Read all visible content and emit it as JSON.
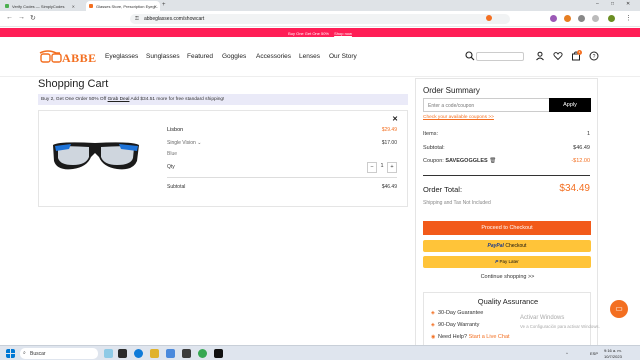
{
  "browser": {
    "tabs": [
      {
        "label": "Verify Codes — SimplyCodes"
      },
      {
        "label": "Glasses Store, Prescription Eyeg..."
      }
    ],
    "url": "abbeglasses.com/showcart"
  },
  "promo_bar": {
    "text": "Buy One Get One 50%",
    "link": "Shop now"
  },
  "header": {
    "logo_text": "ABBE",
    "nav": [
      "Eyeglasses",
      "Sunglasses",
      "Featured",
      "Goggles",
      "Accessories",
      "Lenses",
      "Our Story"
    ],
    "cart_count": "1"
  },
  "page": {
    "title": "Shopping Cart",
    "promo_strip": {
      "before": "Buy 2, Get One Order 50% Off ",
      "link": "Grab Deal",
      "after": "  Add $34.51 more for free standard shipping!"
    }
  },
  "cart_item": {
    "name": "Lisbon",
    "price": "$29.49",
    "lens": "Single Vision",
    "lens_price": "$17.00",
    "color": "Blue",
    "qty_label": "Qty",
    "qty": "1",
    "subtotal_label": "Subtotal",
    "subtotal": "$46.49"
  },
  "summary": {
    "title": "Order Summary",
    "coupon_placeholder": "Enter a code/coupon",
    "apply_label": "Apply",
    "coupon_link": "Check your available coupons >>",
    "items_label": "Items:",
    "items_value": "1",
    "subtotal_label": "Subtotal:",
    "subtotal_value": "$46.49",
    "coupon_label": "Coupon:",
    "coupon_code": "SAVEGOGGLES",
    "coupon_value": "-$12.00",
    "total_label": "Order Total:",
    "total_value": "$34.49",
    "shipping_note": "Shipping and Tax Not Included",
    "checkout_label": "Proceed to Checkout",
    "paypal_brand": "PayPal",
    "paypal_label": "Checkout",
    "paylater_label": "Pay Later",
    "continue_label": "Continue shopping >>",
    "qa_title": "Quality Assurance",
    "qa_items": [
      "30-Day Guarantee",
      "90-Day Warranty"
    ],
    "help_label": "Need Help?",
    "help_link": "Start a Live Chat"
  },
  "overlay": {
    "watermark_title": "Activar Windows",
    "watermark_sub": "Ve a Configuración para activar Windows."
  },
  "taskbar": {
    "search": "Buscar",
    "time": "9:16 a. m.",
    "date": "10/7/2023",
    "lang": "ESP"
  },
  "colors": {
    "accent": "#f36f21",
    "promo": "#ff1e56",
    "checkout": "#f25a1a",
    "paypal": "#ffc439"
  }
}
